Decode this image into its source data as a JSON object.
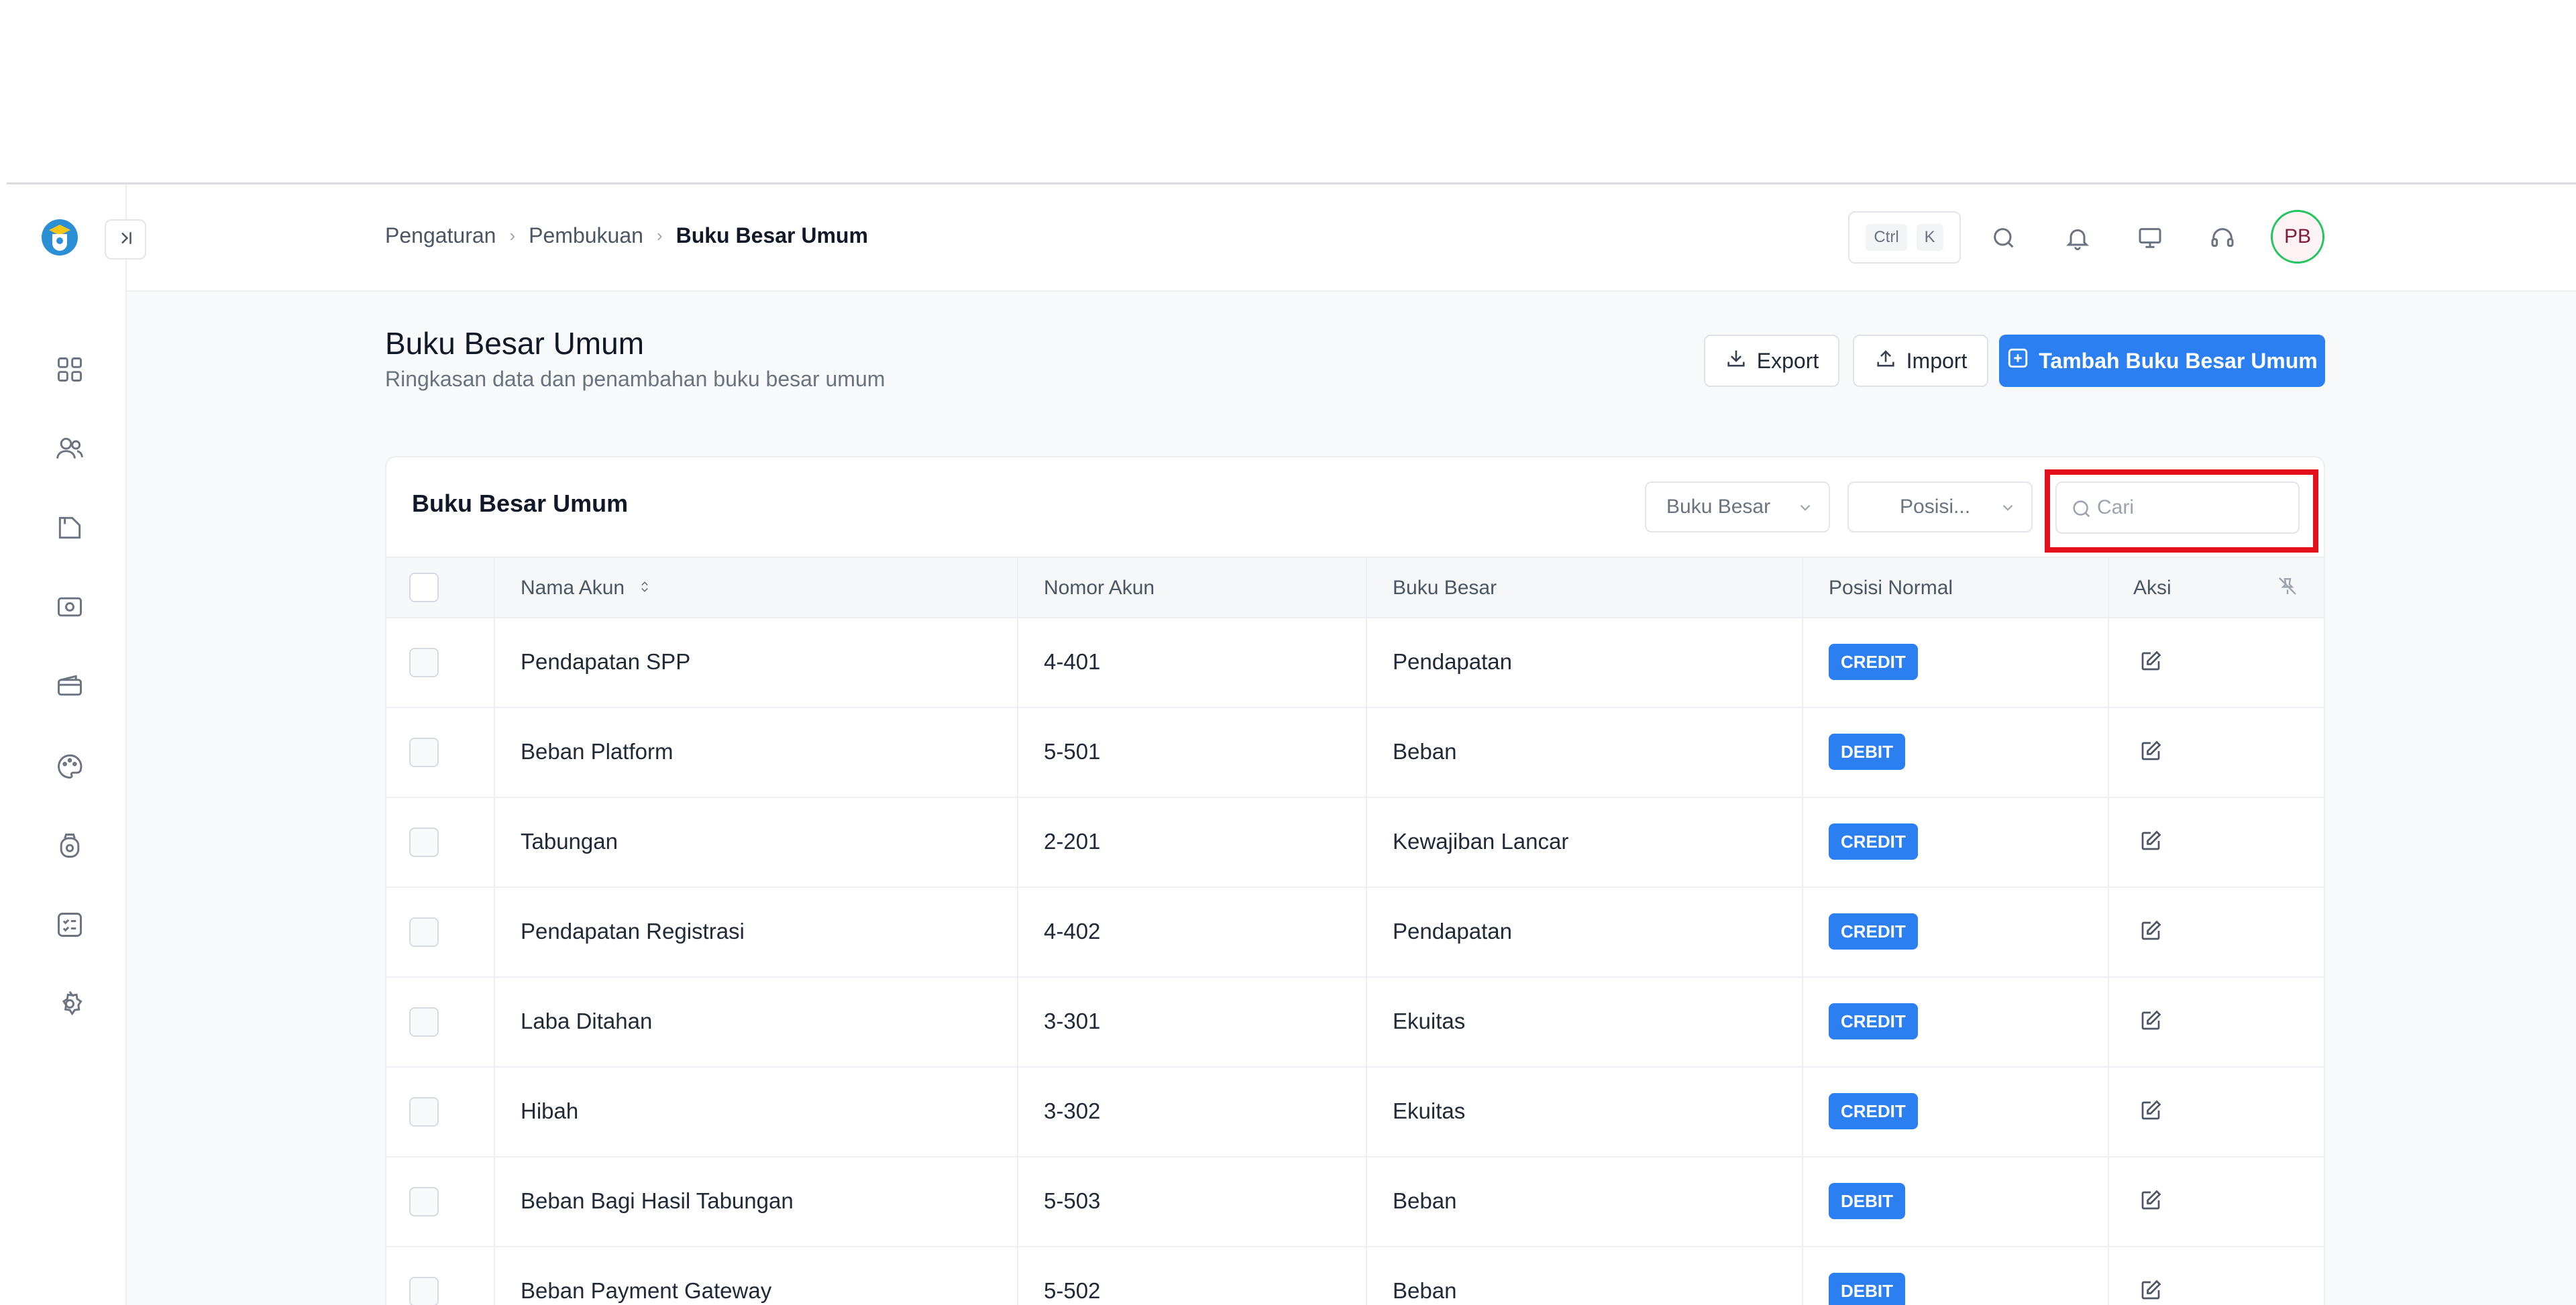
{
  "breadcrumb": {
    "item1": "Pengaturan",
    "item2": "Pembukuan",
    "current": "Buku Besar Umum"
  },
  "shortcut": {
    "key1": "Ctrl",
    "key2": "K"
  },
  "user": {
    "initials": "PB"
  },
  "page": {
    "title": "Buku Besar Umum",
    "subtitle": "Ringkasan data dan penambahan buku besar umum"
  },
  "actions": {
    "export": "Export",
    "import": "Import",
    "add": "Tambah Buku Besar Umum"
  },
  "card": {
    "title": "Buku Besar Umum",
    "filter_ledger": "Buku Besar",
    "filter_position": "Posisi...",
    "search_placeholder": "Cari"
  },
  "table": {
    "columns": {
      "name": "Nama Akun",
      "number": "Nomor Akun",
      "ledger": "Buku Besar",
      "position": "Posisi Normal",
      "action": "Aksi"
    },
    "rows": [
      {
        "name": "Pendapatan SPP",
        "number": "4-401",
        "ledger": "Pendapatan",
        "position": "CREDIT"
      },
      {
        "name": "Beban Platform",
        "number": "5-501",
        "ledger": "Beban",
        "position": "DEBIT"
      },
      {
        "name": "Tabungan",
        "number": "2-201",
        "ledger": "Kewajiban Lancar",
        "position": "CREDIT"
      },
      {
        "name": "Pendapatan Registrasi",
        "number": "4-402",
        "ledger": "Pendapatan",
        "position": "CREDIT"
      },
      {
        "name": "Laba Ditahan",
        "number": "3-301",
        "ledger": "Ekuitas",
        "position": "CREDIT"
      },
      {
        "name": "Hibah",
        "number": "3-302",
        "ledger": "Ekuitas",
        "position": "CREDIT"
      },
      {
        "name": "Beban Bagi Hasil Tabungan",
        "number": "5-503",
        "ledger": "Beban",
        "position": "DEBIT"
      },
      {
        "name": "Beban Payment Gateway",
        "number": "5-502",
        "ledger": "Beban",
        "position": "DEBIT"
      }
    ]
  },
  "colors": {
    "primary": "#2b7ff0",
    "highlight": "#e3101c",
    "avatar_ring": "#22c55e"
  },
  "icons": [
    "logo-icon",
    "sidebar-toggle-icon",
    "dashboard-icon",
    "users-icon",
    "folder-icon",
    "camera-icon",
    "wallet-icon",
    "palette-icon",
    "bag-icon",
    "checklist-icon",
    "settings-icon",
    "search-icon",
    "bell-icon",
    "monitor-icon",
    "headset-icon",
    "download-icon",
    "upload-icon",
    "plus-square-icon",
    "edit-icon",
    "pin-off-icon",
    "sort-icon",
    "chevron-down-icon"
  ]
}
